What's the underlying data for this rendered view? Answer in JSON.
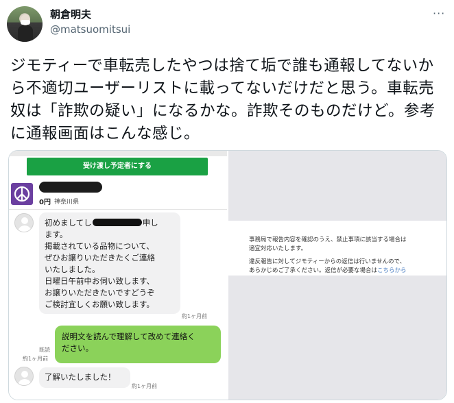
{
  "tweet": {
    "display_name": "朝倉明夫",
    "handle": "@matsuomitsui",
    "more_label": "···",
    "text": "ジモティーで車転売したやつは捨て垢で誰も通報してないから不適切ユーザーリストに載ってないだけだと思う。車転売奴は「詐欺の疑い」になるかな。詐欺そのものだけど。参考に通報画面はこんな感じ。"
  },
  "screenshot": {
    "green_button_label": "受け渡し予定者にする",
    "seller": {
      "price": "0円",
      "prefecture": "神奈川県"
    },
    "messages": [
      {
        "type": "received",
        "lines_before": "初めましてし",
        "lines_after": "申し",
        "body": "ます。\n掲載されている品物について、\nぜひお譲りいただきたくご連絡\nいたしました。\n日曜日午前中お伺い致します、\nお譲りいただきたいですどうぞ\nご検討宜しくお願い致します。",
        "time": "約1ヶ月前"
      },
      {
        "type": "sent",
        "body": "説明文を読んで理解して改めて連絡く\nださい。",
        "read_label": "既読",
        "time": "約1ヶ月前"
      },
      {
        "type": "received",
        "body": "了解いたしました！",
        "time": "約1ヶ月前"
      }
    ],
    "notice": {
      "p1": "事務局で報告内容を確認のうえ、禁止事項に該当する場合は\n適宜対応いたします。",
      "p2": "違反報告に対してジモティーからの返信は行いませんので、\nあらかじめご了承ください。返信が必要な場合は",
      "p2_link": "こちらから"
    }
  }
}
